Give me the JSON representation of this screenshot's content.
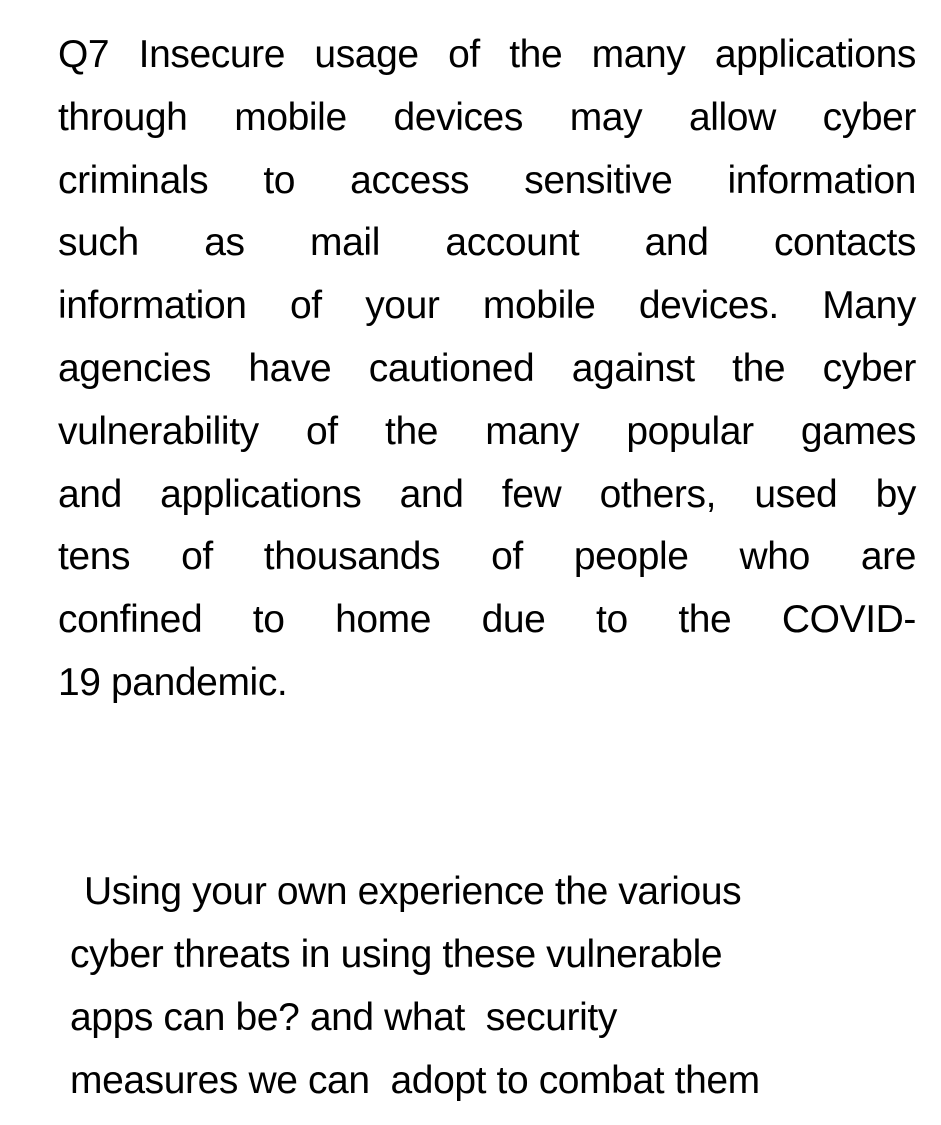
{
  "question": {
    "number": "Q7",
    "paragraph1_lines": [
      "Q7 Insecure usage of the many applications",
      "through mobile devices may allow cyber",
      "criminals to access sensitive information",
      "such as mail account and contacts",
      "information of your mobile devices. Many",
      "agencies have cautioned against the cyber",
      "vulnerability of the many popular games",
      "and applications and few others, used by",
      "tens of thousands of people who are",
      "confined to home  due to the COVID-",
      "19 pandemic."
    ],
    "paragraph2_lines": [
      "Using your own experience the various",
      "cyber threats in using these vulnerable",
      "apps can be? and what  security",
      "measures we can  adopt to combat them"
    ]
  }
}
